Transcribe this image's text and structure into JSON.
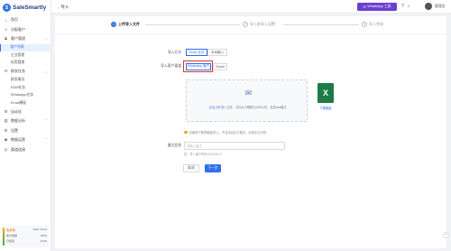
{
  "app": {
    "logo_text": "SaleSmartly",
    "logo_glyph": "S"
  },
  "sidebar": {
    "items": [
      {
        "label": "首页",
        "icon": "home-icon",
        "glyph": "⌂"
      },
      {
        "label": "分配客户",
        "icon": "user-assign-icon",
        "glyph": "☺"
      },
      {
        "label": "客户管理",
        "icon": "customers-icon",
        "glyph": "♟",
        "expanded": true,
        "sub": [
          {
            "label": "客户列表",
            "active": true
          },
          {
            "label": "企业管理"
          },
          {
            "label": "标签管理"
          }
        ]
      },
      {
        "label": "群发任务",
        "icon": "broadcast-icon",
        "glyph": "✉",
        "expanded": true,
        "sub": [
          {
            "label": "群发概况"
          },
          {
            "label": "EDM任务"
          },
          {
            "label": "WhatsApp任务"
          },
          {
            "label": "Email模板"
          }
        ]
      },
      {
        "label": "自动化",
        "icon": "automation-icon",
        "glyph": "⚙"
      },
      {
        "label": "数据分析",
        "icon": "analytics-icon",
        "glyph": "▥"
      },
      {
        "label": "设置",
        "icon": "settings-icon",
        "glyph": "⚙"
      },
      {
        "label": "数据运营",
        "icon": "data-ops-icon",
        "glyph": "◉"
      },
      {
        "label": "渠道连接",
        "icon": "channels-icon",
        "glyph": "◎"
      }
    ],
    "quota": {
      "title": "免费版",
      "expiry": "2023-12-31",
      "rows": [
        {
          "k": "客户数量",
          "v": "18/50"
        },
        {
          "k": "已使用",
          "v": "13/29"
        }
      ]
    }
  },
  "topbar": {
    "back_glyph": "‹",
    "title": "导入",
    "whatsapp_label": "WhatsApp 工具",
    "user_name": "管理员",
    "icons": [
      "help-icon",
      "bell-icon"
    ]
  },
  "steps": [
    {
      "num": "1",
      "label": "上传导入文件",
      "active": true
    },
    {
      "num": "2",
      "label": "导入前导入设置",
      "active": false
    },
    {
      "num": "3",
      "label": "导入完成",
      "active": false
    }
  ],
  "form": {
    "import_mode_label": "导入方式",
    "import_mode_options": [
      {
        "label": "Excel 文件",
        "selected": true
      },
      {
        "label": "手动输入",
        "selected": false
      }
    ],
    "channel_label": "导入客户渠道",
    "channel_options": [
      {
        "label": "WhatsApp 客户",
        "selected": true
      },
      {
        "label": "Email",
        "selected": false
      }
    ],
    "upload_text": "拖入文件，文件大小限制为10M以内，支持xlsx格式",
    "upload_link": "点击上传",
    "template_label": "下载模板",
    "tip_text": "请使用下载的模板导入，不支持自定义格式，否则无法识别",
    "remark_label": "备注信息",
    "remark_placeholder": "请输入备注",
    "remark_hint": "如：导入客户时间 2023.08.17",
    "cancel_label": "取消",
    "next_label": "下一步"
  },
  "colors": {
    "primary": "#2f6fea",
    "whatsapp_purple": "#6c3fd1",
    "highlight_red": "#d9342b",
    "excel_green": "#1e7b45"
  }
}
